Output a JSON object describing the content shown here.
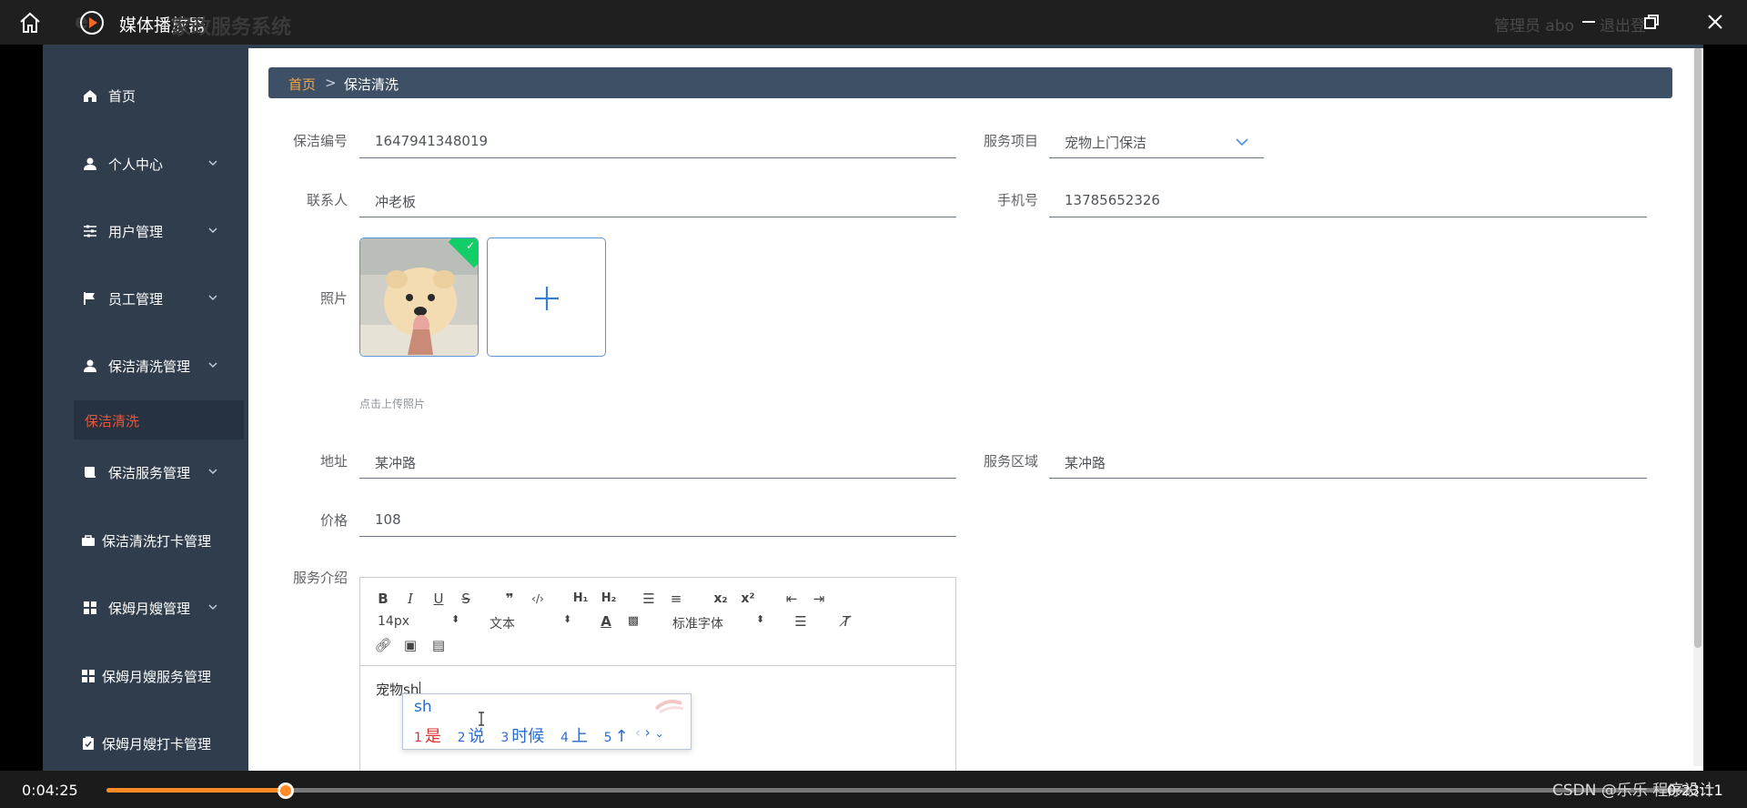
{
  "player": {
    "title": "媒体播放器",
    "time_current": "0:04:25",
    "time_total": "0:23:11",
    "progress": 0.113
  },
  "ghost": {
    "system_e": "e",
    "system_title": "家政服务系统",
    "admin": "管理员 abo",
    "logout": "退出登"
  },
  "sidebar": {
    "items": [
      {
        "label": "首页",
        "icon": "home-icon"
      },
      {
        "label": "个人中心",
        "icon": "user-icon"
      },
      {
        "label": "用户管理",
        "icon": "sliders-icon"
      },
      {
        "label": "员工管理",
        "icon": "flag-icon"
      },
      {
        "label": "保洁清洗管理",
        "icon": "user-icon"
      },
      {
        "label": "保洁服务管理",
        "icon": "book-icon"
      },
      {
        "label": "保洁清洗打卡管理",
        "icon": "briefcase-icon"
      },
      {
        "label": "保姆月嫂管理",
        "icon": "grid-icon"
      },
      {
        "label": "保姆月嫂服务管理",
        "icon": "grid-icon"
      },
      {
        "label": "保姆月嫂打卡管理",
        "icon": "clipboard-icon"
      }
    ],
    "active_sub": "保洁清洗"
  },
  "breadcrumb": {
    "home": "首页",
    "sep": ">",
    "current": "保洁清洗"
  },
  "form": {
    "code_label": "保洁编号",
    "code_value": "1647941348019",
    "service_label": "服务项目",
    "service_value": "宠物上门保洁",
    "contact_label": "联系人",
    "contact_value": "冲老板",
    "phone_label": "手机号",
    "phone_value": "13785652326",
    "photo_label": "照片",
    "photo_hint": "点击上传照片",
    "address_label": "地址",
    "address_value": "某冲路",
    "area_label": "服务区域",
    "area_value": "某冲路",
    "price_label": "价格",
    "price_value": "108",
    "intro_label": "服务介绍"
  },
  "editor": {
    "font_size": "14px",
    "text_style": "文本",
    "font_family": "标准字体",
    "content_prefix": "宠物",
    "content_typing": "sh"
  },
  "ime": {
    "composition": "sh",
    "candidates": [
      {
        "n": "1",
        "text": "是"
      },
      {
        "n": "2",
        "text": "说"
      },
      {
        "n": "3",
        "text": "时候"
      },
      {
        "n": "4",
        "text": "上"
      },
      {
        "n": "5",
        "text": "↑"
      }
    ]
  },
  "watermark": "CSDN @乐乐 程序设计"
}
